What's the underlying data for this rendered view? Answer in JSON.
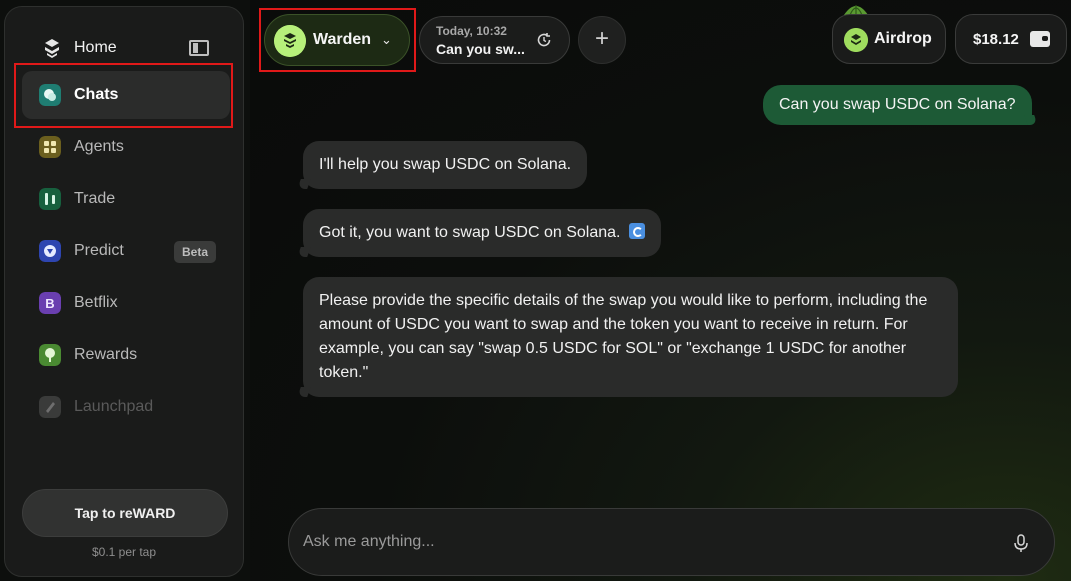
{
  "sidebar": {
    "home_label": "Home",
    "items": [
      {
        "label": "Chats",
        "icon": "chats-icon",
        "color": "#2fb6a6"
      },
      {
        "label": "Agents",
        "icon": "agents-icon",
        "color": "#8a7a2a"
      },
      {
        "label": "Trade",
        "icon": "trade-icon",
        "color": "#1e7a4e"
      },
      {
        "label": "Predict",
        "icon": "predict-icon",
        "color": "#3b54c7",
        "badge": "Beta"
      },
      {
        "label": "Betflix",
        "icon": "betflix-icon",
        "color": "#7a4fc2"
      },
      {
        "label": "Rewards",
        "icon": "rewards-icon",
        "color": "#5a9a3c"
      },
      {
        "label": "Launchpad",
        "icon": "launchpad-icon",
        "color": "#4a4a4a"
      }
    ],
    "reward_button": "Tap to reWARD",
    "reward_sub": "$0.1 per tap"
  },
  "header": {
    "agent_name": "Warden",
    "chat_time": "Today, 10:32",
    "chat_title": "Can you sw...",
    "airdrop_label": "Airdrop",
    "balance": "$18.12"
  },
  "messages": {
    "user_1": "Can you swap USDC on Solana?",
    "bot_1": "I'll help you swap USDC on Solana.",
    "bot_2": "Got it, you want to swap USDC on Solana.",
    "bot_3": "Please provide the specific details of the swap you would like to perform, including the amount of USDC you want to swap and the token you want to receive in return. For example, you can say \"swap 0.5 USDC for SOL\" or \"exchange 1 USDC for another token.\""
  },
  "input": {
    "placeholder": "Ask me anything..."
  },
  "colors": {
    "accent_green": "#b7f07a",
    "user_bubble": "#1d5a36",
    "highlight": "#e01919"
  }
}
